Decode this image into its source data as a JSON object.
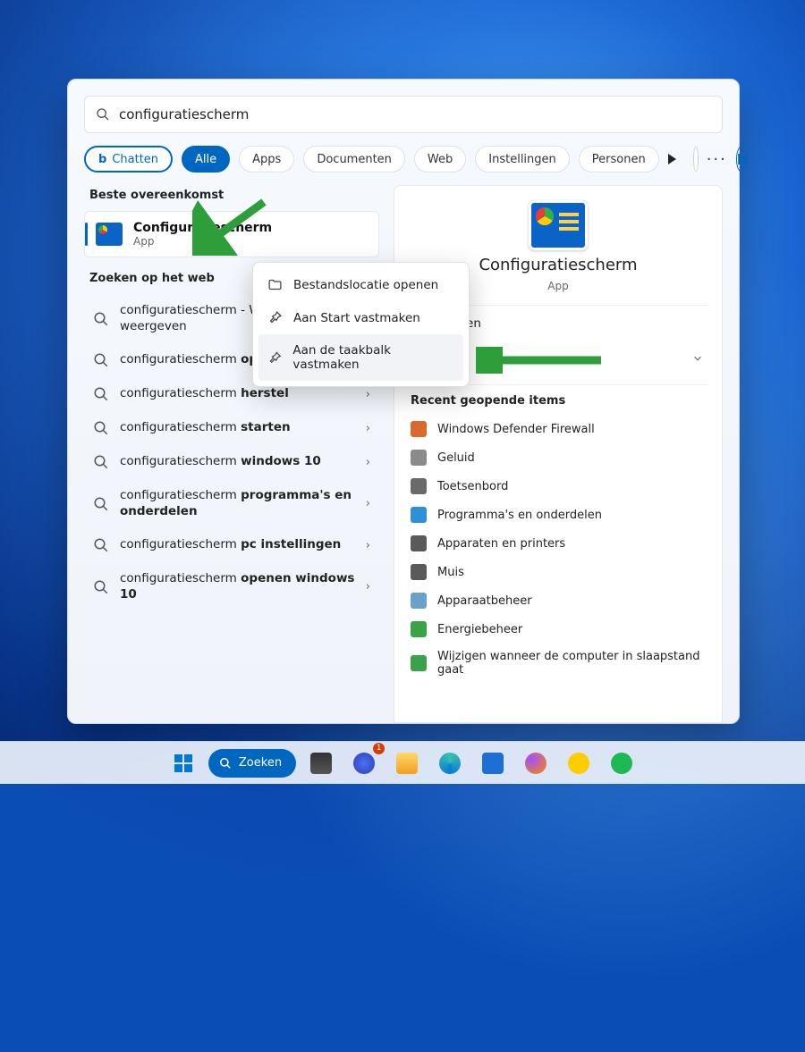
{
  "search": {
    "query": "configuratiescherm"
  },
  "filters": {
    "chat": "Chatten",
    "all": "Alle",
    "apps": "Apps",
    "documents": "Documenten",
    "web": "Web",
    "settings": "Instellingen",
    "people": "Personen"
  },
  "left": {
    "best_match_header": "Beste overeenkomst",
    "best_match": {
      "title": "Configuratiescherm",
      "subtitle": "App"
    },
    "web_header": "Zoeken op het web",
    "web_items": [
      {
        "prefix": "configuratiescherm",
        "bold": "",
        "suffix": " - Webresultaten weergeven"
      },
      {
        "prefix": "configuratiescherm ",
        "bold": "openen",
        "suffix": ""
      },
      {
        "prefix": "configuratiescherm ",
        "bold": "herstel",
        "suffix": ""
      },
      {
        "prefix": "configuratiescherm ",
        "bold": "starten",
        "suffix": ""
      },
      {
        "prefix": "configuratiescherm ",
        "bold": "windows 10",
        "suffix": ""
      },
      {
        "prefix": "configuratiescherm ",
        "bold": "programma's en onderdelen",
        "suffix": ""
      },
      {
        "prefix": "configuratiescherm ",
        "bold": "pc instellingen",
        "suffix": ""
      },
      {
        "prefix": "configuratiescherm ",
        "bold": "openen windows 10",
        "suffix": ""
      }
    ]
  },
  "preview": {
    "title": "Configuratiescherm",
    "subtitle": "App",
    "open": "Openen",
    "recent_header": "Recent geopende items",
    "recent": [
      "Windows Defender Firewall",
      "Geluid",
      "Toetsenbord",
      "Programma's en onderdelen",
      "Apparaten en printers",
      "Muis",
      "Apparaatbeheer",
      "Energiebeheer",
      "Wijzigen wanneer de computer in slaapstand gaat"
    ]
  },
  "context_menu": {
    "items": [
      "Bestandslocatie openen",
      "Aan Start vastmaken",
      "Aan de taakbalk vastmaken"
    ]
  },
  "taskbar": {
    "search_label": "Zoeken",
    "chat_badge": "1"
  },
  "icon_colors": {
    "recent": [
      "#d86b2b",
      "#8a8a8a",
      "#6a6a6a",
      "#2f8fd8",
      "#5a5a5a",
      "#5a5a5a",
      "#6aa0cc",
      "#3aa34a",
      "#3aa34a"
    ]
  }
}
